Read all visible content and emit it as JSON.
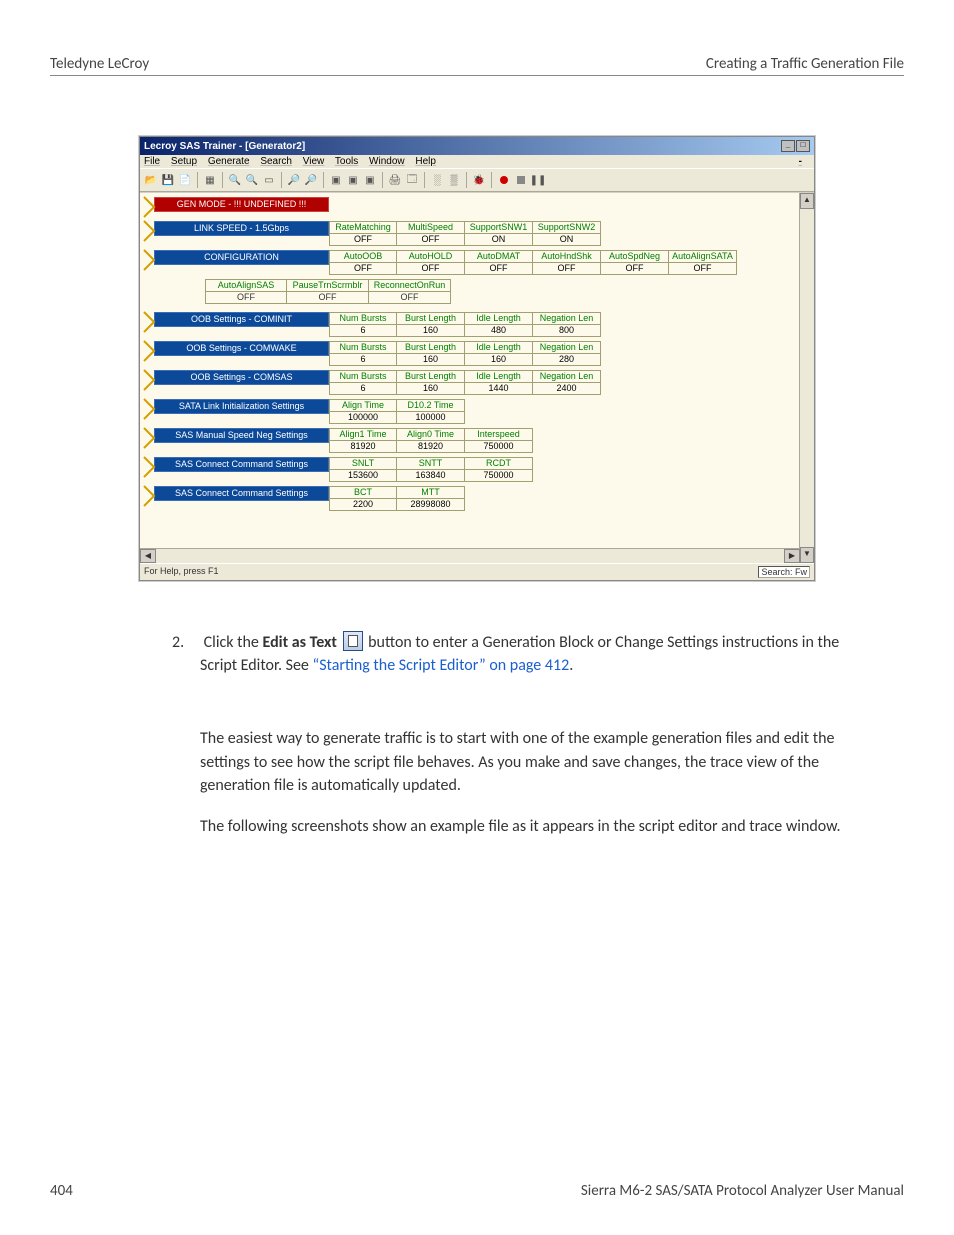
{
  "header": {
    "left": "Teledyne LeCroy",
    "right": "Creating a Traffic Generation File"
  },
  "footer": {
    "left": "404",
    "right": "Sierra M6-2 SAS/SATA Protocol Analyzer User Manual"
  },
  "screenshot": {
    "title": "Lecroy SAS Trainer - [Generator2]",
    "menus": [
      "File",
      "Setup",
      "Generate",
      "Search",
      "View",
      "Tools",
      "Window",
      "Help"
    ],
    "status_left": "For Help, press F1",
    "status_right": "Search: Fw",
    "rows": [
      {
        "type": "red",
        "label": "GEN MODE - !!! UNDEFINED !!!",
        "cells": []
      },
      {
        "label": "LINK SPEED - 1.5Gbps",
        "cells": [
          {
            "h": "RateMatching",
            "v": "OFF"
          },
          {
            "h": "MultiSpeed",
            "v": "OFF"
          },
          {
            "h": "SupportSNW1",
            "v": "ON"
          },
          {
            "h": "SupportSNW2",
            "v": "ON"
          }
        ]
      },
      {
        "label": "CONFIGURATION",
        "cells": [
          {
            "h": "AutoOOB",
            "v": "OFF"
          },
          {
            "h": "AutoHOLD",
            "v": "OFF"
          },
          {
            "h": "AutoDMAT",
            "v": "OFF"
          },
          {
            "h": "AutoHndShk",
            "v": "OFF"
          },
          {
            "h": "AutoSpdNeg",
            "v": "OFF"
          },
          {
            "h": "AutoAlignSATA",
            "v": "OFF"
          }
        ]
      },
      {
        "type": "extra",
        "cells": [
          {
            "h": "AutoAlignSAS",
            "v": "OFF"
          },
          {
            "h": "PauseTrnScrmblr",
            "v": "OFF"
          },
          {
            "h": "ReconnectOnRun",
            "v": "OFF"
          }
        ]
      },
      {
        "label": "OOB Settings - COMINIT",
        "cells": [
          {
            "h": "Num Bursts",
            "v": "6"
          },
          {
            "h": "Burst Length",
            "v": "160"
          },
          {
            "h": "Idle Length",
            "v": "480"
          },
          {
            "h": "Negation Len",
            "v": "800"
          }
        ]
      },
      {
        "label": "OOB Settings - COMWAKE",
        "cells": [
          {
            "h": "Num Bursts",
            "v": "6"
          },
          {
            "h": "Burst Length",
            "v": "160"
          },
          {
            "h": "Idle Length",
            "v": "160"
          },
          {
            "h": "Negation Len",
            "v": "280"
          }
        ]
      },
      {
        "label": "OOB Settings - COMSAS",
        "cells": [
          {
            "h": "Num Bursts",
            "v": "6"
          },
          {
            "h": "Burst Length",
            "v": "160"
          },
          {
            "h": "Idle Length",
            "v": "1440"
          },
          {
            "h": "Negation Len",
            "v": "2400"
          }
        ]
      },
      {
        "label": "SATA Link Initialization Settings",
        "cells": [
          {
            "h": "Align Time",
            "v": "100000"
          },
          {
            "h": "D10.2 Time",
            "v": "100000"
          }
        ]
      },
      {
        "label": "SAS Manual Speed Neg Settings",
        "cells": [
          {
            "h": "Align1 Time",
            "v": "81920"
          },
          {
            "h": "Align0 Time",
            "v": "81920"
          },
          {
            "h": "Interspeed",
            "v": "750000"
          }
        ]
      },
      {
        "label": "SAS Connect Command Settings",
        "cells": [
          {
            "h": "SNLT",
            "v": "153600"
          },
          {
            "h": "SNTT",
            "v": "163840"
          },
          {
            "h": "RCDT",
            "v": "750000"
          }
        ]
      },
      {
        "label": "SAS Connect Command Settings",
        "cells": [
          {
            "h": "BCT",
            "v": "2200"
          },
          {
            "h": "MTT",
            "v": "28998080"
          }
        ]
      }
    ]
  },
  "body": {
    "step_num": "2.",
    "step_a": "Click the ",
    "step_bold": "Edit as Text",
    "step_b": " button to enter a Generation Block or Change Settings instructions in the Script Editor. See ",
    "step_link": "“Starting the Script Editor” on page 412",
    "step_c": ".",
    "p1": "The easiest way to generate traffic is to start with one of the example generation files and edit the settings to see how the script file behaves. As you make and save changes, the trace view of the generation file is automatically updated.",
    "p2": "The following screenshots show an example file as it appears in the script editor and trace window."
  }
}
